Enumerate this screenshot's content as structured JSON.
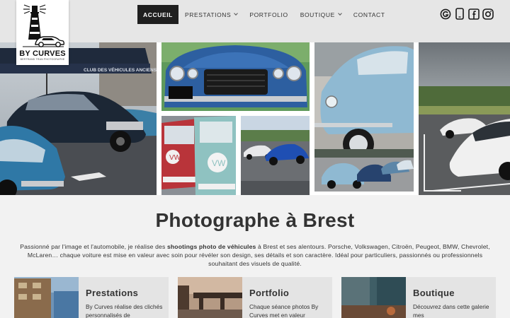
{
  "brand": {
    "name": "BY CURVES",
    "tagline": "BERTRAND TRAN PHOTOGRAPHE"
  },
  "nav": {
    "items": [
      {
        "label": "ACCUEIL",
        "active": true,
        "dropdown": false
      },
      {
        "label": "PRESTATIONS",
        "active": false,
        "dropdown": true
      },
      {
        "label": "PORTFOLIO",
        "active": false,
        "dropdown": false
      },
      {
        "label": "BOUTIQUE",
        "active": false,
        "dropdown": true
      },
      {
        "label": "CONTACT",
        "active": false,
        "dropdown": false
      }
    ]
  },
  "socials": [
    "google-icon",
    "phone-icon",
    "facebook-icon",
    "instagram-icon"
  ],
  "hero": {
    "title": "Photographe à Brest",
    "intro_before": "Passionné par l'image et l'automobile, je réalise des ",
    "intro_bold": "shootings photo de véhicules",
    "intro_after": " à Brest et ses alentours. Porsche, Volkswagen, Citroën, Peugeot, BMW, Chevrolet, McLaren… chaque voiture est mise en valeur avec soin pour révéler son design, ses détails et son caractère. Idéal pour particuliers, passionnés ou professionnels souhaitant des visuels de qualité."
  },
  "gallery": {
    "banner_text": "CLUB DES VÉHICULES ANCIENS GOUESNO"
  },
  "cards": [
    {
      "title": "Prestations",
      "text": "By Curves réalise des clichés personnalisés de"
    },
    {
      "title": "Portfolio",
      "text": "Chaque séance photos By Curves met en valeur"
    },
    {
      "title": "Boutique",
      "text": "Découvrez dans cette galerie mes"
    }
  ],
  "colors": {
    "header_bg": "#e6e6e6",
    "nav_active_bg": "#1f1f1f",
    "page_bg": "#f2f2f2",
    "card_bg": "#e4e4e4"
  }
}
